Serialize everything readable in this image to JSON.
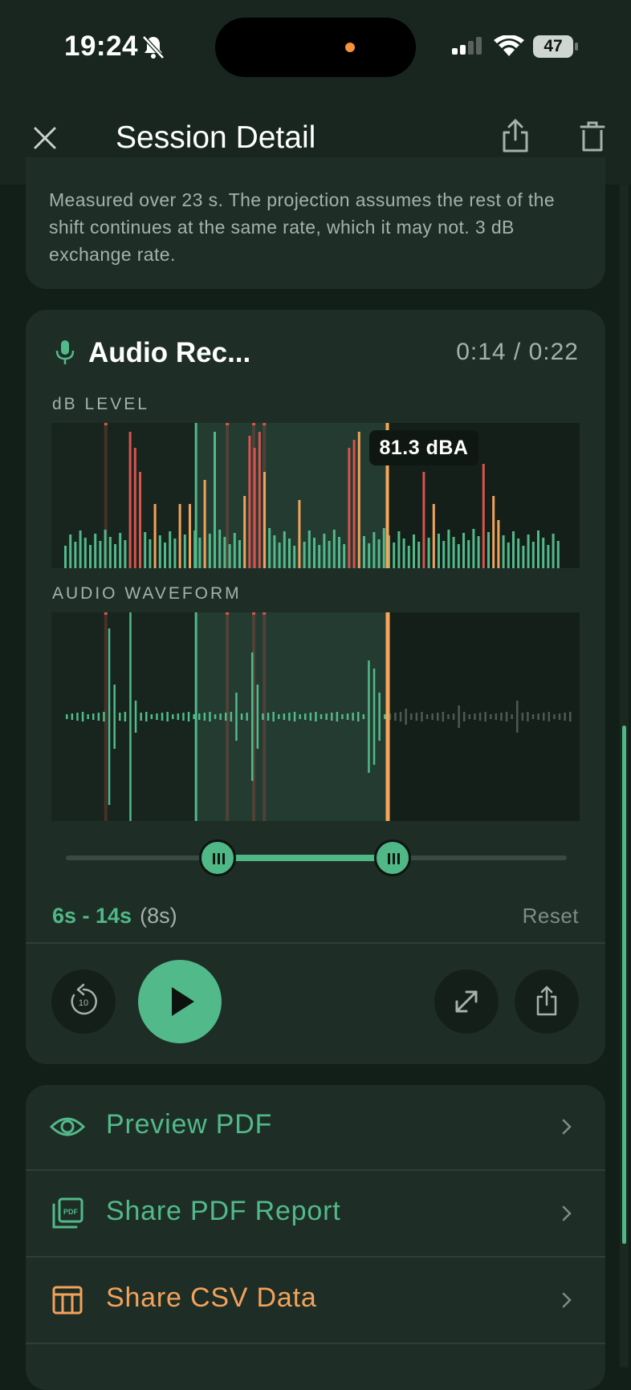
{
  "status": {
    "time": "19:24",
    "battery": "47"
  },
  "nav": {
    "title": "Session Detail"
  },
  "note": {
    "text": "Measured over 23 s. The projection assumes the rest of the shift continues at the same rate, which it may not. 3 dB exchange rate."
  },
  "audio": {
    "title": "Audio Rec...",
    "time": "0:14 / 0:22",
    "db_label": "dB LEVEL",
    "wave_label": "AUDIO WAVEFORM",
    "tooltip": "81.3 dBA",
    "range": "6s - 14s",
    "duration": "(8s)",
    "reset": "Reset",
    "playhead_fraction": 0.636,
    "selection": [
      0.273,
      0.636
    ]
  },
  "actions": [
    {
      "label": "Preview PDF",
      "icon": "eye-icon",
      "color": "#52b98a"
    },
    {
      "label": "Share PDF Report",
      "icon": "pdf-icon",
      "color": "#52b98a"
    },
    {
      "label": "Share CSV Data",
      "icon": "table-icon",
      "color": "#f2a25a"
    }
  ],
  "colors": {
    "accent": "#52b98a",
    "warn": "#f2a25a",
    "danger": "#d9534f",
    "playhead": "#f5a55c"
  }
}
